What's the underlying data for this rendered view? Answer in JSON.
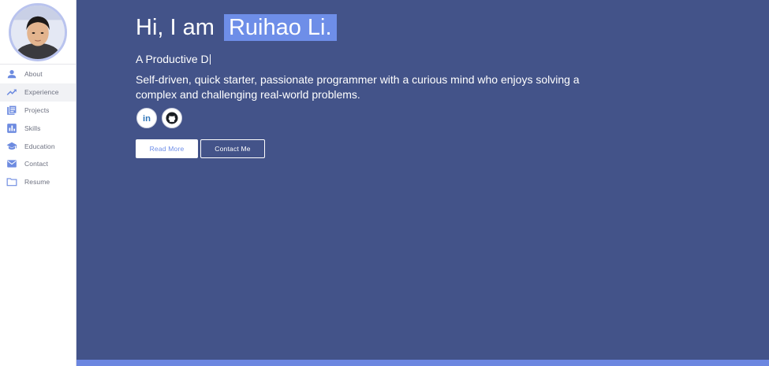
{
  "sidebar": {
    "items": [
      {
        "label": "About",
        "icon": "person-icon"
      },
      {
        "label": "Experience",
        "icon": "trending-up-icon"
      },
      {
        "label": "Projects",
        "icon": "projects-icon"
      },
      {
        "label": "Skills",
        "icon": "bar-chart-icon"
      },
      {
        "label": "Education",
        "icon": "graduation-cap-icon"
      },
      {
        "label": "Contact",
        "icon": "mail-icon"
      },
      {
        "label": "Resume",
        "icon": "folder-icon"
      }
    ],
    "active_item": "Experience"
  },
  "hero": {
    "greeting": "Hi, I am",
    "name": "Ruihao Li.",
    "typed_text": "A Productive D",
    "description": "Self-driven, quick starter, passionate programmer with a curious mind who enjoys solving a complex and challenging real-world problems.",
    "socials": [
      {
        "name": "LinkedIn",
        "icon": "linkedin-icon",
        "text": "in"
      },
      {
        "name": "GitHub",
        "icon": "github-icon"
      }
    ],
    "buttons": {
      "read_more": "Read More",
      "contact_me": "Contact Me"
    }
  },
  "colors": {
    "main_bg": "#435389",
    "accent": "#6e8ee8",
    "sidebar_icon": "#6d8be0"
  }
}
